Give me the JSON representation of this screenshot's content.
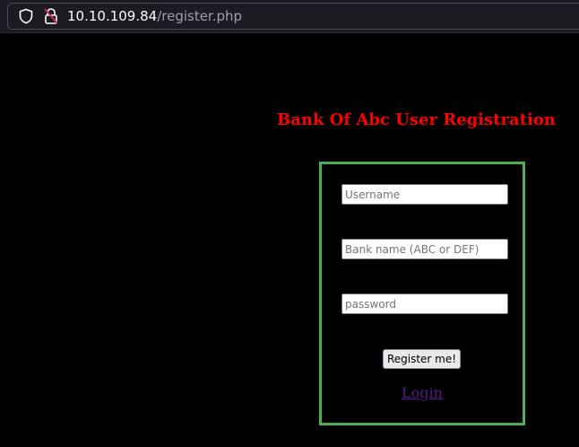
{
  "browser": {
    "url_host": "10.10.109.84",
    "url_path": "/register.php",
    "icons": {
      "tracking_protection": "shield-icon",
      "connection": "insecure-lock-icon"
    }
  },
  "page": {
    "title": "Bank Of Abc User Registration",
    "title_color": "#ff0000",
    "form_border_color": "#4caf50",
    "background_color": "#000000"
  },
  "form": {
    "username": {
      "placeholder": "Username",
      "value": ""
    },
    "bank": {
      "placeholder": "Bank name (ABC or DEF)",
      "value": ""
    },
    "password": {
      "placeholder": "password",
      "value": ""
    },
    "submit_label": "Register me!",
    "login_link_label": "Login",
    "link_color": "#551a8b"
  }
}
